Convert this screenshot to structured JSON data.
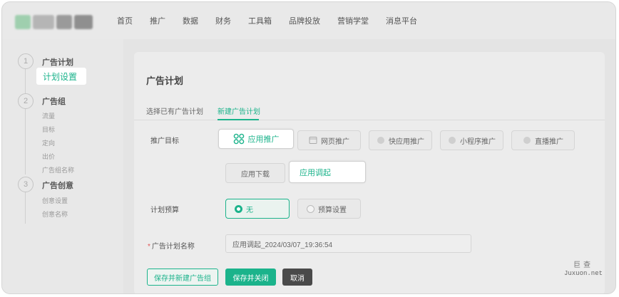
{
  "colors": {
    "accent": "#1bb38b",
    "dark_button": "#4a4a4a"
  },
  "nav": {
    "items": [
      "首页",
      "推广",
      "数据",
      "财务",
      "工具箱",
      "品牌投放",
      "营销学堂",
      "消息平台"
    ]
  },
  "sidebar": {
    "steps": [
      "1",
      "2",
      "3"
    ],
    "plan_title": "广告计划",
    "plan_active": "计划设置",
    "group_title": "广告组",
    "group_items": [
      "流量",
      "目标",
      "定向",
      "出价",
      "广告组名称"
    ],
    "creative_title": "广告创意",
    "creative_items": [
      "创意设置",
      "创意名称"
    ]
  },
  "main": {
    "title": "广告计划",
    "tabs": [
      "选择已有广告计划",
      "新建广告计划"
    ],
    "promo_label": "推广目标",
    "promo_options": [
      {
        "label": "应用推广",
        "icon": "app-grid-icon"
      },
      {
        "label": "网页推广",
        "icon": "webpage-icon"
      },
      {
        "label": "快应用推广",
        "icon": "quick-app-icon"
      },
      {
        "label": "小程序推广",
        "icon": "mini-program-icon"
      },
      {
        "label": "直播推广",
        "icon": "live-icon"
      }
    ],
    "sub_options": [
      "应用下载",
      "应用调起"
    ],
    "budget_label": "计划预算",
    "budget_options": [
      "无",
      "预算设置"
    ],
    "name_label": "广告计划名称",
    "name_required": "*",
    "name_value": "应用调起_2024/03/07_19:36:54",
    "buttons": {
      "save_new_group": "保存并新建广告组",
      "save_close": "保存并关闭",
      "cancel": "取消"
    }
  },
  "corner": {
    "brand": "巨查",
    "url": "Juxuon.net"
  }
}
